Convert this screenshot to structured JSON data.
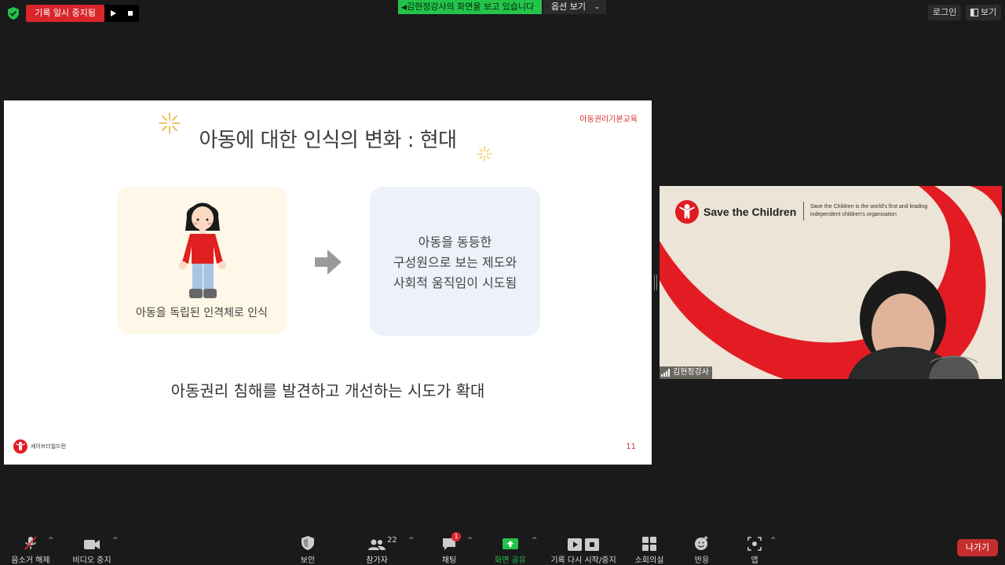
{
  "top_bar": {
    "recording_label": "기록 일시 중지됨",
    "share_banner": "김현정강사의 화면을 보고 있습니다",
    "options_label": "옵션 보기",
    "login_label": "로그인",
    "view_label": "보기"
  },
  "slide": {
    "tag": "아동권리기본교육",
    "title": "아동에 대한 인식의 변화 : 현대",
    "left_card_text": "아동을 독립된 인격체로 인식",
    "right_card_lines": [
      "아동을 동등한",
      "구성원으로 보는 제도와",
      "사회적 움직임이 시도됨"
    ],
    "bottom_text": "아동권리 침해를 발견하고 개선하는 시도가 확대",
    "logo_text": "세이브더칠드런",
    "page_number": "11"
  },
  "video": {
    "org_name": "Save the Children",
    "tagline": "Save the Children is the world's first and leading independent children's organisation",
    "participant_name": "김현정강사"
  },
  "toolbar": {
    "items": [
      {
        "label": "음소거 해제"
      },
      {
        "label": "비디오 중지"
      },
      {
        "label": "보안"
      },
      {
        "label": "참가자",
        "count": "22"
      },
      {
        "label": "채팅",
        "badge": "1"
      },
      {
        "label": "화면 공유"
      },
      {
        "label": "기록 다시 시작/중지"
      },
      {
        "label": "소회의실"
      },
      {
        "label": "반응"
      },
      {
        "label": "앱"
      }
    ],
    "leave_label": "나가기"
  },
  "colors": {
    "accent_green": "#23c44a",
    "record_red": "#d8262b",
    "brand_red": "#e11b22"
  }
}
